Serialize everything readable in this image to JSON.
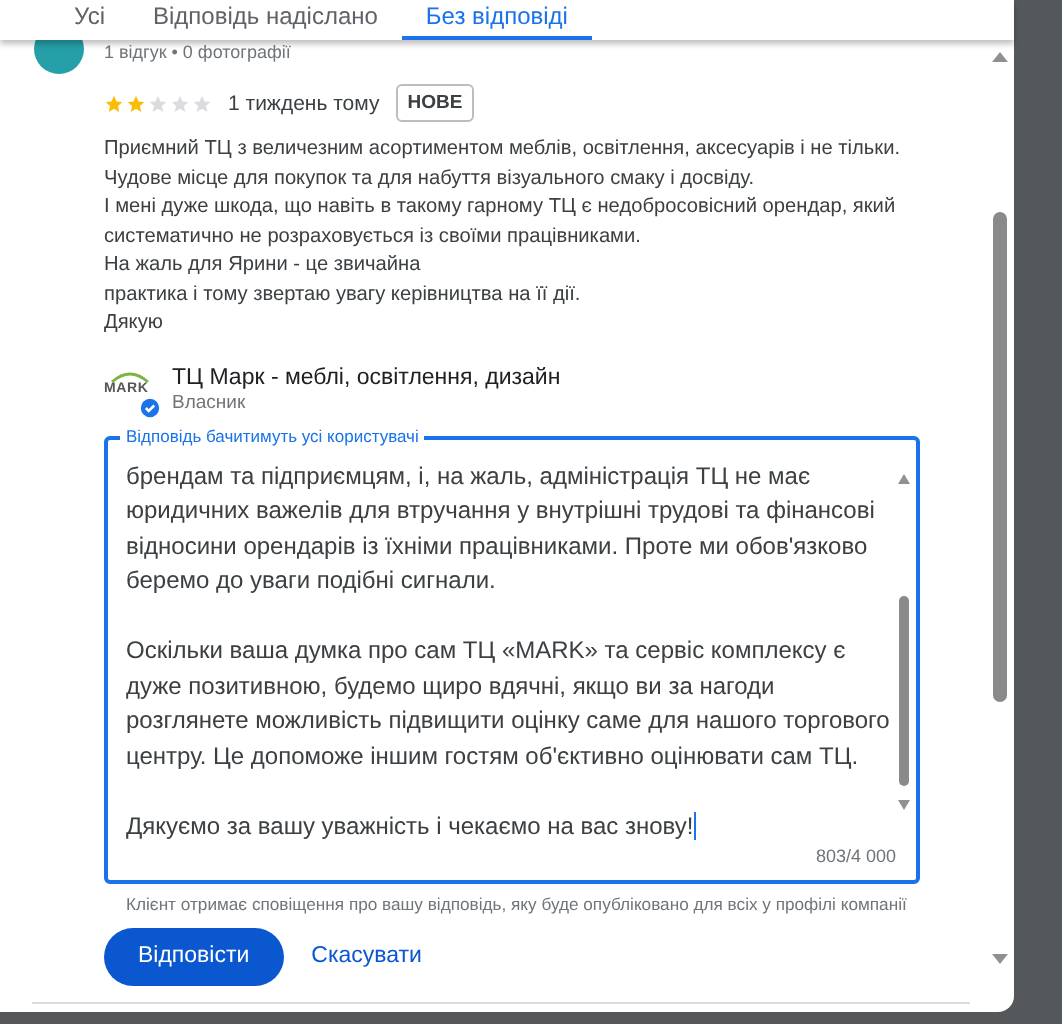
{
  "tabs": [
    {
      "label": "Усі",
      "selected": false
    },
    {
      "label": "Відповідь надіслано",
      "selected": false
    },
    {
      "label": "Без відповіді",
      "selected": true
    }
  ],
  "review": {
    "author_meta": "1 відгук • 0 фотографії",
    "stars": 2,
    "time": "1 тиждень тому",
    "badge": "НОВЕ",
    "lines": [
      "Приємний ТЦ з величезним асортиментом меблів, освітлення, аксесуарів і не тільки.",
      "Чудове місце для покупок та для набуття візуального смаку і досвіду.",
      "І мені дуже шкода, що навіть в такому гарному ТЦ є недобросовісний орендар, який",
      "систематично не розраховується із своїми працівниками.",
      "На жаль для Ярини - це звичайна",
      "практика і тому звертаю увагу керівництва на її дії.",
      "Дякую"
    ]
  },
  "owner": {
    "logo_text": "MARK",
    "verified": true,
    "name": "ТЦ Марк - меблі, освітлення, дизайн",
    "role": "Власник"
  },
  "reply_field": {
    "label": "Відповідь бачитимуть усі користувачі",
    "focused": true,
    "paragraphs": [
      [
        "брендам та підприємцям, і, на жаль, адміністрація ТЦ не має",
        "юридичних важелів для втручання у внутрішні трудові та фінансові",
        "відносини орендарів із їхніми працівниками. Проте ми обов'язково",
        "беремо до уваги подібні сигнали."
      ],
      [
        "Оскільки ваша думка про сам ТЦ «MARK» та сервіс комплексу є",
        "дуже позитивною, будемо щиро вдячні, якщо ви за нагоди",
        "розглянете можливість підвищити оцінку саме для нашого торгового",
        "центру. Це допоможе іншим гостям об'єктивно оцінювати сам ТЦ."
      ],
      [
        "Дякуємо за вашу уважність і чекаємо на вас знову!"
      ]
    ],
    "counter": "803/4 000"
  },
  "hint": "Клієнт отримає сповіщення про вашу відповідь, яку буде опубліковано для всіх у профілі компанії",
  "buttons": [
    {
      "kind": "primary",
      "label": "Відповісти"
    },
    {
      "kind": "text",
      "label": "Скасувати"
    }
  ]
}
